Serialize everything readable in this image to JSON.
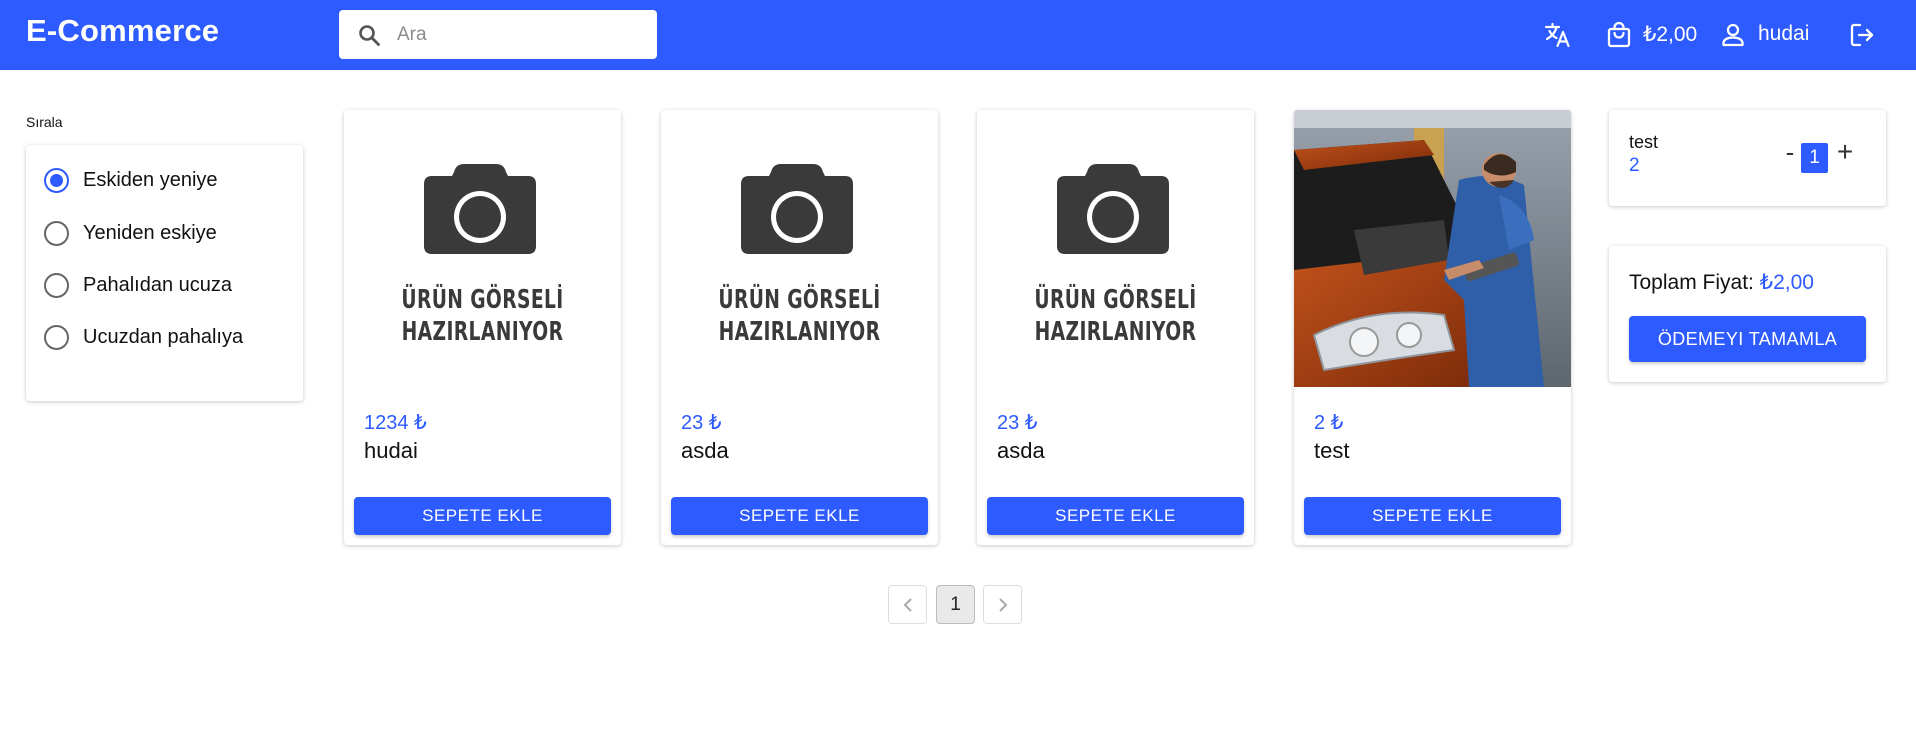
{
  "header": {
    "brand": "E-Commerce",
    "search_placeholder": "Ara",
    "cart_total": "₺2,00",
    "username": "hudai",
    "icons": [
      "translate-icon",
      "shopping-bag-icon",
      "user-icon",
      "logout-icon"
    ],
    "bg_color": "#2d5bff"
  },
  "sort": {
    "title": "Sırala",
    "options": [
      {
        "label": "Eskiden yeniye",
        "checked": true
      },
      {
        "label": "Yeniden eskiye",
        "checked": false
      },
      {
        "label": "Pahalıdan ucuza",
        "checked": false
      },
      {
        "label": "Ucuzdan pahalıya",
        "checked": false
      }
    ]
  },
  "products": [
    {
      "price": "1234 ₺",
      "name": "hudai",
      "image": "placeholder",
      "button": "SEPETE EKLE"
    },
    {
      "price": "23 ₺",
      "name": "asda",
      "image": "placeholder",
      "button": "SEPETE EKLE"
    },
    {
      "price": "23 ₺",
      "name": "asda",
      "image": "placeholder",
      "button": "SEPETE EKLE"
    },
    {
      "price": "2 ₺",
      "name": "test",
      "image": "photo-mechanic-car-engine",
      "button": "SEPETE EKLE"
    }
  ],
  "placeholder_image": {
    "line1": "ÜRÜN GÖRSELİ",
    "line2": "HAZIRLANIYOR"
  },
  "cart": {
    "item_name": "test",
    "item_price": "2",
    "quantity": "1",
    "minus": "-",
    "plus": "+",
    "total_label": "Toplam Fiyat:",
    "total_value": "₺2,00",
    "checkout_button": "ÖDEMEYI TAMAMLA"
  },
  "pagination": {
    "current": "1"
  }
}
